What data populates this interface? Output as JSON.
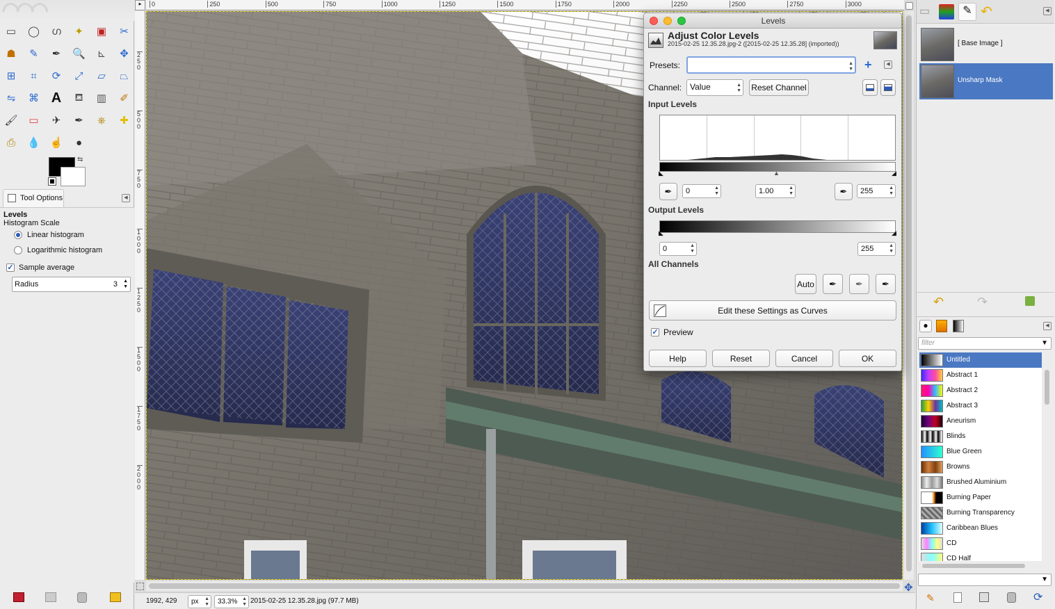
{
  "toolbox": {
    "tool_options_tab": "Tool Options",
    "tool_name": "Levels",
    "histogram_scale_label": "Histogram Scale",
    "linear_label": "Linear histogram",
    "log_label": "Logarithmic histogram",
    "sample_average_label": "Sample average",
    "radius_label": "Radius",
    "radius_value": "3"
  },
  "rulers": {
    "h_ticks": [
      "0",
      "250",
      "500",
      "750",
      "1000",
      "1250",
      "1500",
      "1750",
      "2000",
      "2250",
      "2500",
      "2750",
      "3000"
    ],
    "v_ticks": [
      "250",
      "500",
      "750",
      "1000",
      "1250",
      "1500",
      "1750",
      "2000"
    ]
  },
  "status": {
    "coords": "1992, 429",
    "unit": "px",
    "zoom": "33.3%",
    "file_info": "2015-02-25 12.35.28.jpg (97.7 MB)"
  },
  "levels": {
    "window_title": "Levels",
    "heading": "Adjust Color Levels",
    "subheading": "2015-02-25 12.35.28.jpg-2 ([2015-02-25 12.35.28] (imported))",
    "presets_label": "Presets:",
    "presets_value": "",
    "channel_label": "Channel:",
    "channel_value": "Value",
    "reset_channel": "Reset Channel",
    "input_levels_label": "Input Levels",
    "input_low": "0",
    "input_gamma": "1.00",
    "input_high": "255",
    "output_levels_label": "Output Levels",
    "output_low": "0",
    "output_high": "255",
    "all_channels_label": "All Channels",
    "auto_label": "Auto",
    "edit_curves_label": "Edit these Settings as Curves",
    "preview_label": "Preview",
    "help_label": "Help",
    "reset_label": "Reset",
    "cancel_label": "Cancel",
    "ok_label": "OK"
  },
  "layers": [
    {
      "name": "[ Base Image ]",
      "selected": false
    },
    {
      "name": "Unsharp Mask",
      "selected": true
    }
  ],
  "gradients": {
    "filter_placeholder": "filter",
    "items": [
      {
        "name": "Untitled",
        "c": "linear-gradient(90deg,#000,#fff)"
      },
      {
        "name": "Abstract 1",
        "c": "linear-gradient(90deg,#3a2cff,#c43cff,#ff4ca0,#ffd040)"
      },
      {
        "name": "Abstract 2",
        "c": "linear-gradient(90deg,#ff1a6a,#ff00b0,#30c0ff,#fff700)"
      },
      {
        "name": "Abstract 3",
        "c": "linear-gradient(90deg,#20a040,#ffd000,#7030a0,#00c0c0)"
      },
      {
        "name": "Aneurism",
        "c": "linear-gradient(90deg,#1a0030,#700080,#c00020,#200010)"
      },
      {
        "name": "Blinds",
        "c": "repeating-linear-gradient(90deg,#000 0,#fff 5px,#000 8px)"
      },
      {
        "name": "Blue Green",
        "c": "linear-gradient(90deg,#2090ff,#30ffd0)"
      },
      {
        "name": "Browns",
        "c": "linear-gradient(90deg,#6a3000,#d08040,#804010,#e0a060)"
      },
      {
        "name": "Brushed Aluminium",
        "c": "linear-gradient(90deg,#888,#eee,#999,#ddd,#777)"
      },
      {
        "name": "Burning Paper",
        "c": "linear-gradient(90deg,#fff 0,#fff 50%,#ff8000 60%,#000 70%)"
      },
      {
        "name": "Burning Transparency",
        "c": "repeating-linear-gradient(45deg,#aaa 0,#aaa 3px,#666 3px,#666 6px)"
      },
      {
        "name": "Caribbean Blues",
        "c": "linear-gradient(90deg,#0040a0,#20c0ff,#e0ffff)"
      },
      {
        "name": "CD",
        "c": "linear-gradient(90deg,#ddd,#ff80ff,#80ffff,#ffff80,#ddd)"
      },
      {
        "name": "CD Half",
        "c": "linear-gradient(90deg,#ddd,#80ffff,#ffff80)"
      }
    ]
  },
  "colors": {
    "selection": "#4a78c2"
  }
}
